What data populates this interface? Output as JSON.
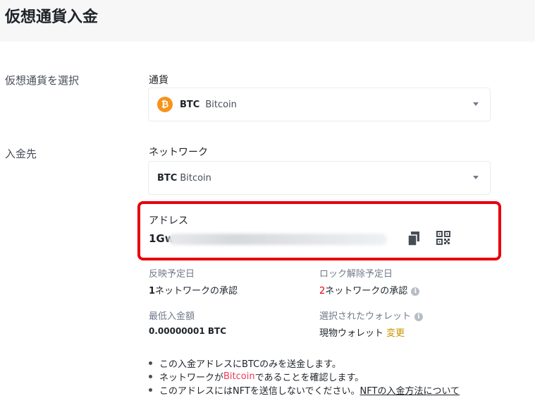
{
  "page": {
    "title": "仮想通貨入金"
  },
  "steps": {
    "select_currency": "仮想通貨を選択",
    "destination": "入金先"
  },
  "currency": {
    "label": "通貨",
    "icon": "bitcoin-icon",
    "icon_glyph": "₿",
    "symbol": "BTC",
    "name": "Bitcoin"
  },
  "network": {
    "label": "ネットワーク",
    "symbol": "BTC",
    "name": "Bitcoin"
  },
  "address": {
    "label": "アドレス",
    "visible_prefix": "1Gw"
  },
  "info": {
    "reflect_label": "反映予定日",
    "reflect_count": "1",
    "reflect_suffix": "ネットワークの承認",
    "unlock_label": "ロック解除予定日",
    "unlock_count": "2",
    "unlock_suffix": "ネットワークの承認",
    "min_label": "最低入金額",
    "min_value": "0.00000001 BTC",
    "wallet_label": "選択されたウォレット",
    "wallet_value": "現物ウォレット",
    "wallet_change": "変更"
  },
  "notes": {
    "note1": "この入金アドレスにBTCのみを送金します。",
    "note2_prefix": "ネットワークが",
    "note2_highlight": "Bitcoin",
    "note2_suffix": "であることを確認します。",
    "note3_text": "このアドレスにはNFTを送信しないでください。",
    "note3_link": "NFTの入金方法について"
  },
  "colors": {
    "highlight_border": "#e8000b",
    "bitcoin": "#f7931a",
    "accent_red": "#e8000b",
    "accent_gold": "#c99400",
    "link_pink": "#e83a5b"
  }
}
